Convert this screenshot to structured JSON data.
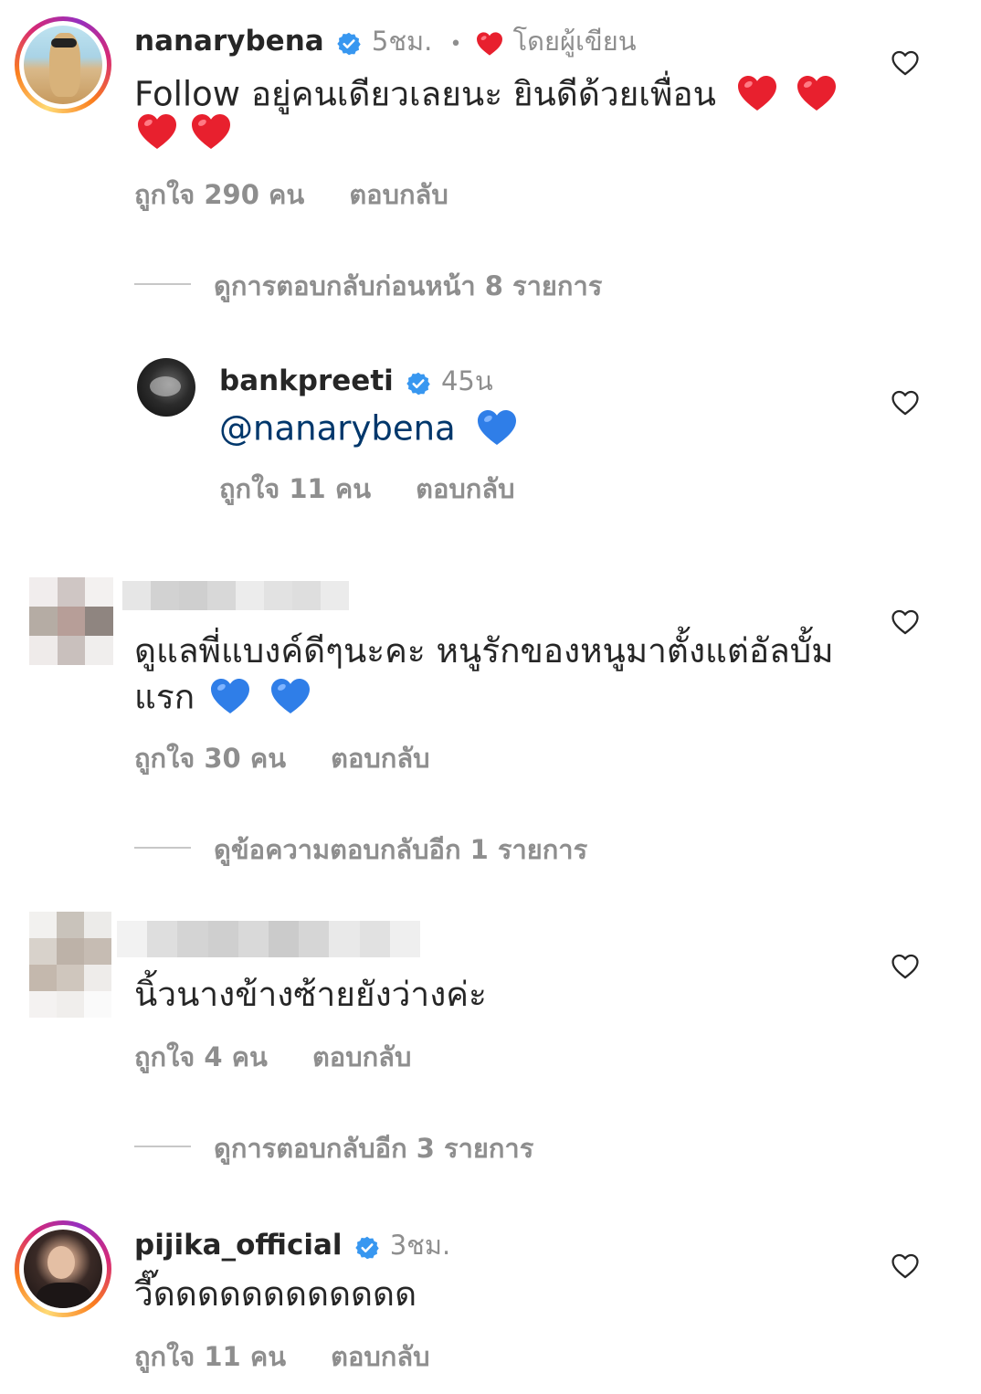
{
  "comments": [
    {
      "username": "nanarybena",
      "time": "5ชม.",
      "dot": "•",
      "by_author": "โดยผู้เขียน",
      "text_line1": "Follow อยู่คนเดียวเลยนะ ยินดีด้วยเพื่อน",
      "likes": "ถูกใจ 290 คน",
      "reply": "ตอบกลับ",
      "view_replies": "ดูการตอบกลับก่อนหน้า 8 รายการ"
    },
    {
      "username": "bankpreeti",
      "time": "45น",
      "mention": "@nanarybena",
      "likes": "ถูกใจ 11 คน",
      "reply": "ตอบกลับ"
    },
    {
      "text_line1": "ดูแลพี่แบงค์ดีๆนะคะ หนูรักของหนูมาตั้งแต่อัลบั้ม",
      "text_line2": "แรก",
      "likes": "ถูกใจ 30 คน",
      "reply": "ตอบกลับ",
      "view_replies": "ดูข้อความตอบกลับอีก 1 รายการ"
    },
    {
      "text_line1": "นิ้วนางข้างซ้ายยังว่างค่ะ",
      "likes": "ถูกใจ 4 คน",
      "reply": "ตอบกลับ",
      "view_replies": "ดูการตอบกลับอีก 3 รายการ"
    },
    {
      "username": "pijika_official",
      "time": "3ชม.",
      "text_line1": "วี๊ดดดดดดดดดดดด",
      "likes": "ถูกใจ 11 คน",
      "reply": "ตอบกลับ"
    }
  ],
  "icons": {
    "verified": "verified-badge-icon",
    "like": "heart-outline-icon",
    "author_heart": "red-heart-icon",
    "red_heart_emoji": "red-heart-emoji",
    "blue_heart_emoji": "blue-heart-emoji"
  },
  "colors": {
    "username": "#262626",
    "secondary": "#8e8e8e",
    "verified": "#3897f0",
    "mention": "#00376b",
    "red_heart": "#ed2f3a",
    "blue_heart": "#2e7de6"
  }
}
